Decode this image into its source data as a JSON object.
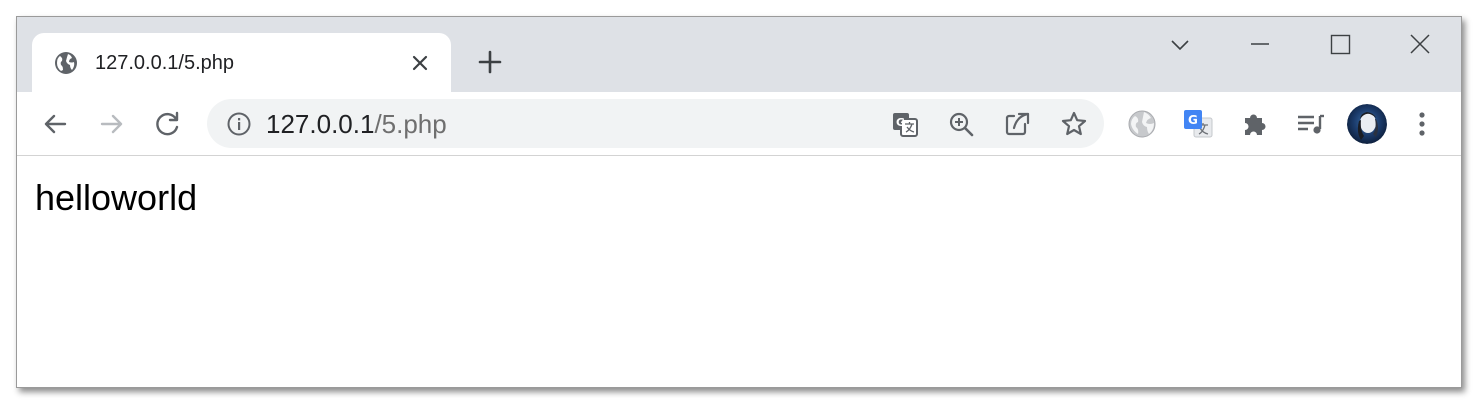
{
  "colors": {
    "titlebar_bg": "#dee1e6",
    "omnibox_bg": "#f1f3f4",
    "icon_color": "#5f6368",
    "url_host_color": "#202124",
    "url_path_color": "#6f6f6f"
  },
  "tab": {
    "title": "127.0.0.1/5.php",
    "favicon": "globe-icon",
    "close_icon": "close-icon"
  },
  "titlebar": {
    "new_tab_icon": "plus-icon",
    "tab_search_icon": "chevron-down-icon",
    "minimize_icon": "minimize-icon",
    "maximize_icon": "maximize-icon",
    "close_icon": "close-icon"
  },
  "toolbar": {
    "back_icon": "arrow-left-icon",
    "forward_icon": "arrow-right-icon",
    "reload_icon": "reload-icon",
    "omnibox": {
      "info_icon": "info-icon",
      "url_host": "127.0.0.1",
      "url_path": "/5.php",
      "translate_icon": "translate-icon",
      "zoom_icon": "zoom-in-icon",
      "share_icon": "share-icon",
      "bookmark_icon": "star-icon"
    },
    "extensions": [
      "globe-extension-icon",
      "google-translate-icon",
      "puzzle-icon",
      "media-queue-icon"
    ],
    "profile_icon": "avatar",
    "menu_icon": "kebab-menu-icon"
  },
  "page": {
    "body_text": "helloworld"
  }
}
